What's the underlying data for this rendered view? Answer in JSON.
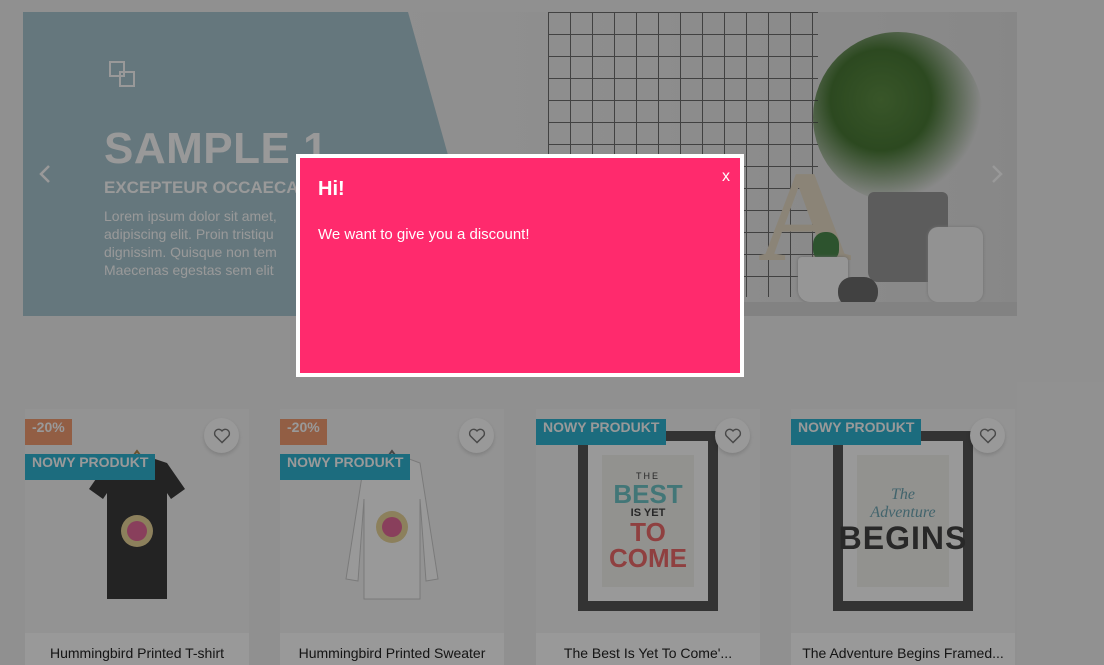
{
  "slider": {
    "title": "SAMPLE 1",
    "subtitle": "EXCEPTEUR OCCAECAT",
    "text_lines": [
      "Lorem ipsum dolor sit amet,",
      "adipiscing elit. Proin tristiqu",
      "dignissim. Quisque non tem",
      "Maecenas egestas sem elit"
    ],
    "prev_icon": "chevron-left-icon",
    "next_icon": "chevron-right-icon"
  },
  "products": [
    {
      "name": "Hummingbird Printed T-shirt",
      "discount": "-20%",
      "badge_new": "NOWY PRODUKT",
      "icon": "heart-icon"
    },
    {
      "name": "Hummingbird Printed Sweater",
      "discount": "-20%",
      "badge_new": "NOWY PRODUKT",
      "icon": "heart-icon"
    },
    {
      "name": "The Best Is Yet To Come'...",
      "badge_new": "NOWY PRODUKT",
      "icon": "heart-icon",
      "poster": {
        "top": "THE",
        "mid1": "BEST",
        "mid2": "IS YET",
        "mid3": "TO",
        "bottom": "COME"
      }
    },
    {
      "name": "The Adventure Begins Framed...",
      "badge_new": "NOWY PRODUKT",
      "icon": "heart-icon",
      "poster": {
        "top": "The",
        "mid": "Adventure",
        "bottom": "BEGINS"
      }
    }
  ],
  "modal": {
    "title": "Hi!",
    "message": "We want to give you a discount!",
    "close_label": "x"
  },
  "colors": {
    "modal_bg": "#ff2a6d",
    "badge_new": "#2fb5d2",
    "badge_discount": "#f39d72",
    "slide_panel": "#a8c7d0"
  }
}
